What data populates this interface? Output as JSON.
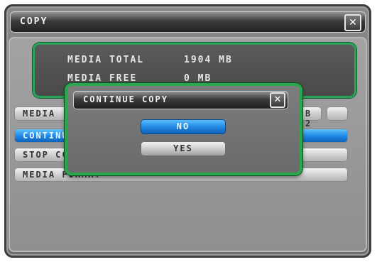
{
  "window": {
    "title": "COPY"
  },
  "info": {
    "rows": [
      {
        "label": "MEDIA TOTAL",
        "value": "1904 MB"
      },
      {
        "label": "MEDIA FREE",
        "value": "0 MB"
      }
    ]
  },
  "menu": {
    "items": [
      {
        "label": "MEDIA",
        "value": "B 2"
      },
      {
        "label": "CONTINU"
      },
      {
        "label": "STOP CC"
      },
      {
        "label": "MEDIA FORMAT"
      }
    ]
  },
  "dialog": {
    "title": "CONTINUE COPY",
    "no_label": "NO",
    "yes_label": "YES"
  },
  "icons": {
    "close": "close-icon",
    "close_glyph": "✕"
  },
  "colors": {
    "accent_green": "#27a35a",
    "selected_blue": "#1e86e4"
  }
}
